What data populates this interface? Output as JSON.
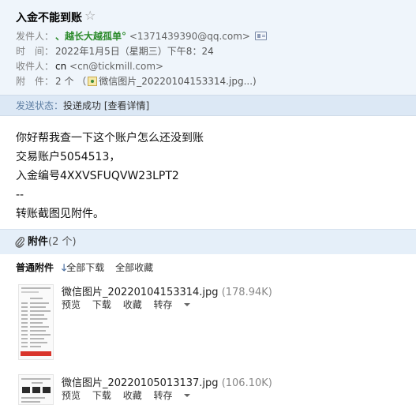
{
  "email": {
    "subject": "入金不能到账",
    "star": "☆",
    "from_label": "发件人：",
    "from_name": "、越长大越孤单°",
    "from_addr": "<1371439390@qq.com>",
    "time_label": "时　间：",
    "time_value": "2022年1月5日（星期三）下午8：24",
    "to_label": "收件人：",
    "to_name": "cn",
    "to_addr": "<cn@tickmill.com>",
    "att_label": "附　件：",
    "att_count": "2 个",
    "att_preview_open": "（",
    "att_preview_name": "微信图片_20220104153314.jpg...)",
    "status_label": "发送状态：",
    "status_value": "投递成功",
    "status_link": "[查看详情]"
  },
  "body": {
    "lines": [
      "你好帮我查一下这个账户怎么还没到账",
      "交易账户5054513，",
      "入金编号4XXVSFUQVW23LPT2",
      "--",
      "转账截图见附件。"
    ]
  },
  "attachments": {
    "title": "附件",
    "count": "(2 个)",
    "kind_label": "普通附件",
    "download_all": "全部下载",
    "collect_all": "全部收藏",
    "files": [
      {
        "name": "微信图片_20220104153314.jpg",
        "size": "(178.94K)",
        "actions": [
          "预览",
          "下载",
          "收藏",
          "转存"
        ]
      },
      {
        "name": "微信图片_20220105013137.jpg",
        "size": "(106.10K)",
        "actions": [
          "预览",
          "下载",
          "收藏",
          "转存"
        ]
      }
    ]
  }
}
